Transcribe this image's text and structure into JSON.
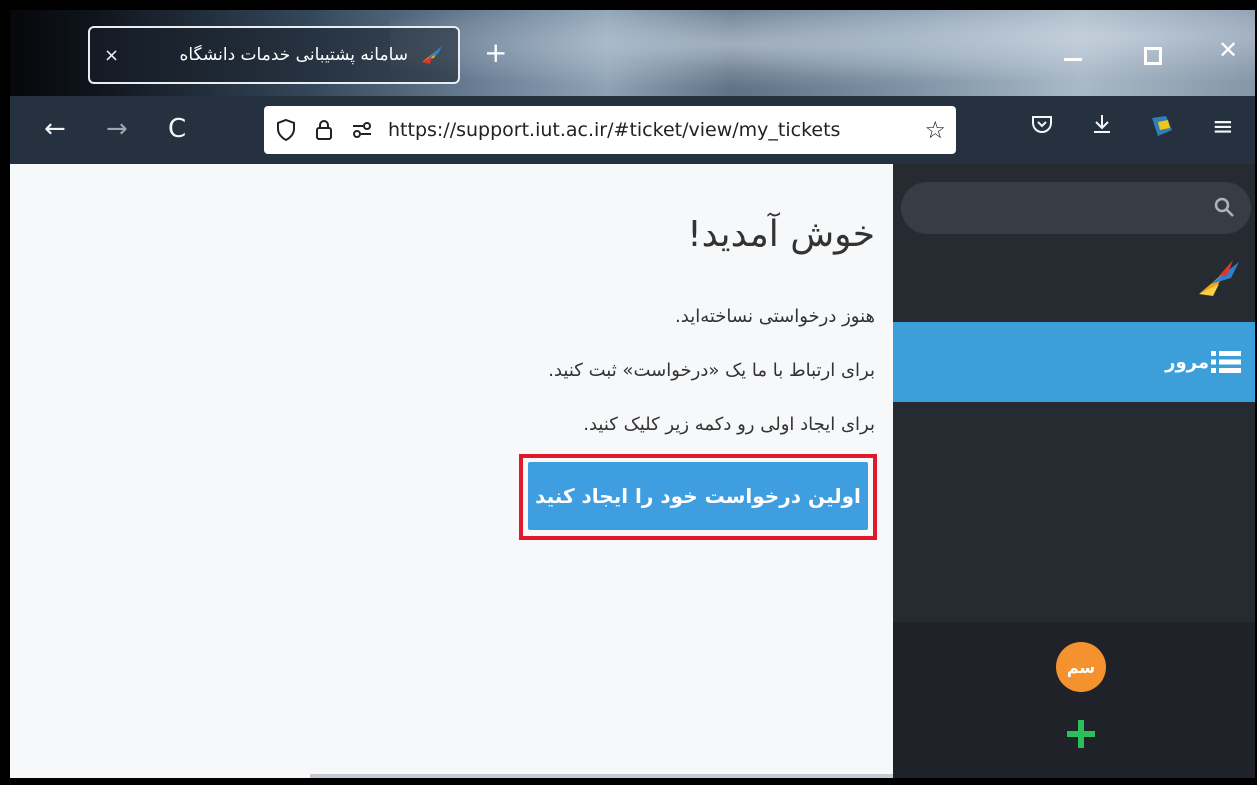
{
  "browser": {
    "tab_title": "سامانه پشتیبانی خدمات دانشگاه",
    "tab_close": "×",
    "new_tab": "+",
    "url": "https://support.iut.ac.ir/#ticket/view/my_tickets",
    "back": "←",
    "forward": "→",
    "reload": "C",
    "bookmark_star": "☆",
    "menu": "≡",
    "close": "✕"
  },
  "main": {
    "welcome": "خوش آمدید!",
    "line1": "هنوز درخواستی نساخته‌اید.",
    "line2": "برای ارتباط با ما یک «درخواست» ثبت کنید.",
    "line3": "برای ایجاد اولی رو دکمه زیر کلیک کنید.",
    "cta_label": "اولین درخواست خود را ایجاد کنید"
  },
  "sidebar": {
    "overview_label": "مرور",
    "avatar_initials": "سم"
  },
  "colors": {
    "accent": "#3e9ee0",
    "highlight_outline": "#e1192c",
    "avatar": "#f4922e",
    "add": "#2ebd5b"
  }
}
